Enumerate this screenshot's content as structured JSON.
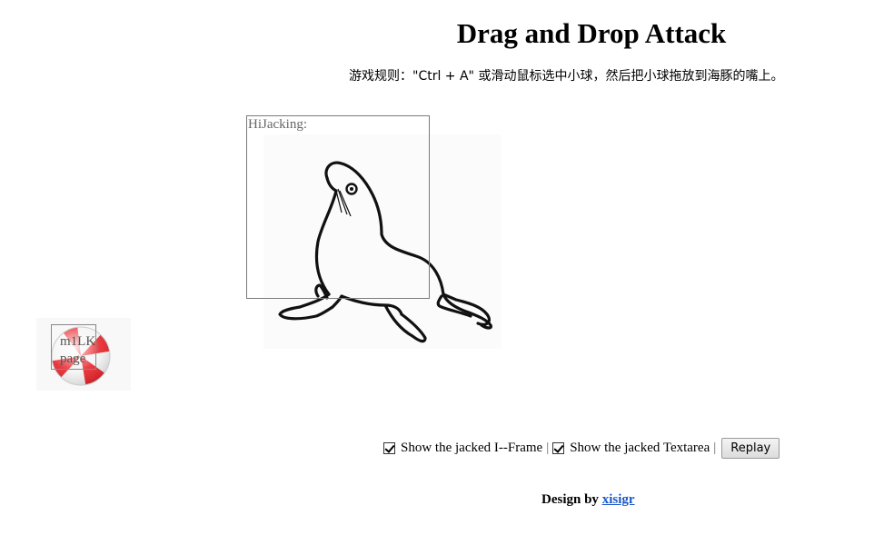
{
  "header": {
    "title": "Drag and Drop Attack",
    "rules": "游戏规则：\"Ctrl + A\" 或滑动鼠标选中小球，然后把小球拖放到海豚的嘴上。"
  },
  "frame": {
    "label": "HiJacking:"
  },
  "textarea": {
    "value": "m1LK! page"
  },
  "controls": {
    "show_iframe_label": "Show the jacked I--Frame",
    "show_textarea_label": "Show the jacked Textarea",
    "separator": "|",
    "replay_label": "Replay",
    "show_iframe_checked": true,
    "show_textarea_checked": true
  },
  "footer": {
    "design_by": "Design by",
    "author": "xisigr"
  },
  "colors": {
    "link": "#1a57c9",
    "ball_red": "#e8242b"
  }
}
